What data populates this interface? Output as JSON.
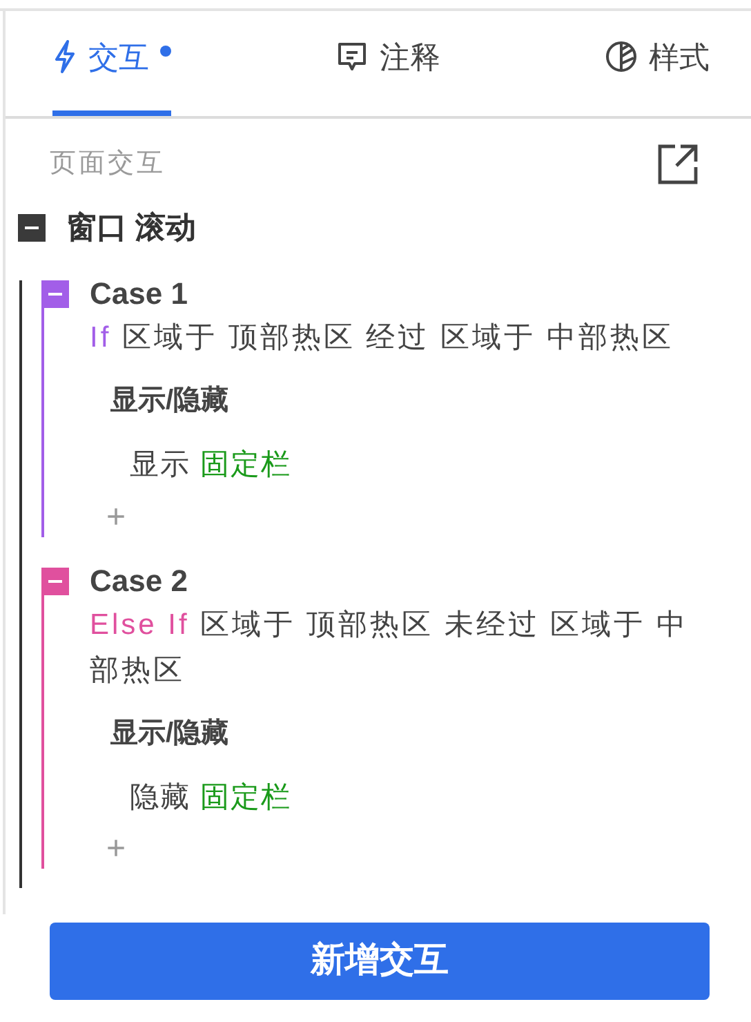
{
  "tabs": [
    {
      "label": "交互",
      "kind": "interaction",
      "selected": true,
      "dot": true
    },
    {
      "label": "注释",
      "kind": "notes",
      "selected": false,
      "dot": false
    },
    {
      "label": "样式",
      "kind": "style",
      "selected": false,
      "dot": false
    }
  ],
  "section_title": "页面交互",
  "event": {
    "title": "窗口 滚动",
    "expanded": true,
    "cases": [
      {
        "title": "Case 1",
        "color": "#a25ee8",
        "expanded": true,
        "keyword": "If",
        "condition": "区域于 顶部热区 经过 区域于 中部热区",
        "actions": [
          {
            "title": "显示/隐藏",
            "verb": "显示",
            "target": "固定栏"
          }
        ],
        "add": "+"
      },
      {
        "title": "Case 2",
        "color": "#e0509e",
        "expanded": true,
        "keyword": "Else If",
        "condition": "区域于 顶部热区 未经过 区域于 中部热区",
        "actions": [
          {
            "title": "显示/隐藏",
            "verb": "隐藏",
            "target": "固定栏"
          }
        ],
        "add": "+"
      }
    ]
  },
  "primary_button": "新增交互"
}
